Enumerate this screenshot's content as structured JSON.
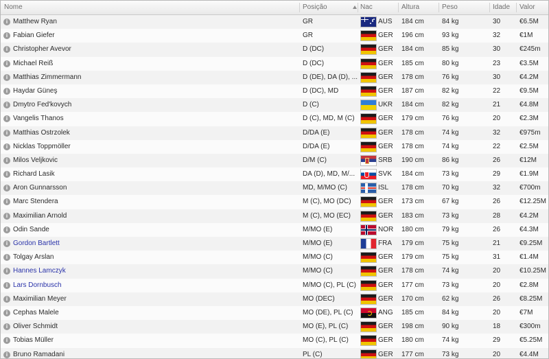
{
  "columns": {
    "name": "Nome",
    "position": "Posição",
    "nationality": "Nac",
    "height": "Altura",
    "weight": "Peso",
    "age": "Idade",
    "value": "Valor"
  },
  "sorted_column": "nationality",
  "colors": {
    "link": "#2a33a9",
    "row_alt": "#f2f2f2",
    "header_text": "#6f6f6f"
  },
  "players": [
    {
      "name": "Matthew Ryan",
      "position": "GR",
      "flag": "aus",
      "nat": "AUS",
      "height": "184 cm",
      "weight": "84 kg",
      "age": "30",
      "value": "€6.5M",
      "link": false
    },
    {
      "name": "Fabian Giefer",
      "position": "GR",
      "flag": "ger",
      "nat": "GER",
      "height": "196 cm",
      "weight": "93 kg",
      "age": "32",
      "value": "€1M",
      "link": false
    },
    {
      "name": "Christopher Avevor",
      "position": "D (DC)",
      "flag": "ger",
      "nat": "GER",
      "height": "184 cm",
      "weight": "85 kg",
      "age": "30",
      "value": "€245m",
      "link": false
    },
    {
      "name": "Michael Reiß",
      "position": "D (DC)",
      "flag": "ger",
      "nat": "GER",
      "height": "185 cm",
      "weight": "80 kg",
      "age": "23",
      "value": "€3.5M",
      "link": false
    },
    {
      "name": "Matthias Zimmermann",
      "position": "D (DE), DA (D), ...",
      "flag": "ger",
      "nat": "GER",
      "height": "178 cm",
      "weight": "76 kg",
      "age": "30",
      "value": "€4.2M",
      "link": false
    },
    {
      "name": "Haydar Güneş",
      "position": "D (DC), MD",
      "flag": "ger",
      "nat": "GER",
      "height": "187 cm",
      "weight": "82 kg",
      "age": "22",
      "value": "€9.5M",
      "link": false
    },
    {
      "name": "Dmytro Fed'kovych",
      "position": "D (C)",
      "flag": "ukr",
      "nat": "UKR",
      "height": "184 cm",
      "weight": "82 kg",
      "age": "21",
      "value": "€4.8M",
      "link": false
    },
    {
      "name": "Vangelis Thanos",
      "position": "D (C), MD, M (C)",
      "flag": "ger",
      "nat": "GER",
      "height": "179 cm",
      "weight": "76 kg",
      "age": "20",
      "value": "€2.3M",
      "link": false
    },
    {
      "name": "Matthias Ostrzolek",
      "position": "D/DA (E)",
      "flag": "ger",
      "nat": "GER",
      "height": "178 cm",
      "weight": "74 kg",
      "age": "32",
      "value": "€975m",
      "link": false
    },
    {
      "name": "Nicklas Toppmöller",
      "position": "D/DA (E)",
      "flag": "ger",
      "nat": "GER",
      "height": "178 cm",
      "weight": "74 kg",
      "age": "22",
      "value": "€2.5M",
      "link": false
    },
    {
      "name": "Milos Veljkovic",
      "position": "D/M (C)",
      "flag": "srb",
      "nat": "SRB",
      "height": "190 cm",
      "weight": "86 kg",
      "age": "26",
      "value": "€12M",
      "link": false
    },
    {
      "name": "Richard Lasik",
      "position": "DA (D), MD, M/...",
      "flag": "svk",
      "nat": "SVK",
      "height": "184 cm",
      "weight": "73 kg",
      "age": "29",
      "value": "€1.9M",
      "link": false
    },
    {
      "name": "Aron Gunnarsson",
      "position": "MD, M/MO (C)",
      "flag": "isl",
      "nat": "ISL",
      "height": "178 cm",
      "weight": "70 kg",
      "age": "32",
      "value": "€700m",
      "link": false
    },
    {
      "name": "Marc Stendera",
      "position": "M (C), MO (DC)",
      "flag": "ger",
      "nat": "GER",
      "height": "173 cm",
      "weight": "67 kg",
      "age": "26",
      "value": "€12.25M",
      "link": false
    },
    {
      "name": "Maximilian Arnold",
      "position": "M (C), MO (EC)",
      "flag": "ger",
      "nat": "GER",
      "height": "183 cm",
      "weight": "73 kg",
      "age": "28",
      "value": "€4.2M",
      "link": false
    },
    {
      "name": "Odin Sande",
      "position": "M/MO (E)",
      "flag": "nor",
      "nat": "NOR",
      "height": "180 cm",
      "weight": "79 kg",
      "age": "26",
      "value": "€4.3M",
      "link": false
    },
    {
      "name": "Gordon Bartlett",
      "position": "M/MO (E)",
      "flag": "fra",
      "nat": "FRA",
      "height": "179 cm",
      "weight": "75 kg",
      "age": "21",
      "value": "€9.25M",
      "link": true
    },
    {
      "name": "Tolgay Arslan",
      "position": "M/MO (C)",
      "flag": "ger",
      "nat": "GER",
      "height": "179 cm",
      "weight": "75 kg",
      "age": "31",
      "value": "€1.4M",
      "link": false
    },
    {
      "name": "Hannes Lamczyk",
      "position": "M/MO (C)",
      "flag": "ger",
      "nat": "GER",
      "height": "178 cm",
      "weight": "74 kg",
      "age": "20",
      "value": "€10.25M",
      "link": true
    },
    {
      "name": "Lars Dornbusch",
      "position": "M/MO (C), PL (C)",
      "flag": "ger",
      "nat": "GER",
      "height": "177 cm",
      "weight": "73 kg",
      "age": "20",
      "value": "€2.8M",
      "link": true
    },
    {
      "name": "Maximilian Meyer",
      "position": "MO (DEC)",
      "flag": "ger",
      "nat": "GER",
      "height": "170 cm",
      "weight": "62 kg",
      "age": "26",
      "value": "€8.25M",
      "link": false
    },
    {
      "name": "Cephas Malele",
      "position": "MO (DE), PL (C)",
      "flag": "ang",
      "nat": "ANG",
      "height": "185 cm",
      "weight": "84 kg",
      "age": "20",
      "value": "€7M",
      "link": false
    },
    {
      "name": "Oliver Schmidt",
      "position": "MO (E), PL (C)",
      "flag": "ger",
      "nat": "GER",
      "height": "198 cm",
      "weight": "90 kg",
      "age": "18",
      "value": "€300m",
      "link": false
    },
    {
      "name": "Tobias Müller",
      "position": "MO (C), PL (C)",
      "flag": "ger",
      "nat": "GER",
      "height": "180 cm",
      "weight": "74 kg",
      "age": "29",
      "value": "€5.25M",
      "link": false
    },
    {
      "name": "Bruno Ramadani",
      "position": "PL (C)",
      "flag": "ger",
      "nat": "GER",
      "height": "177 cm",
      "weight": "73 kg",
      "age": "20",
      "value": "€4.4M",
      "link": false
    }
  ]
}
